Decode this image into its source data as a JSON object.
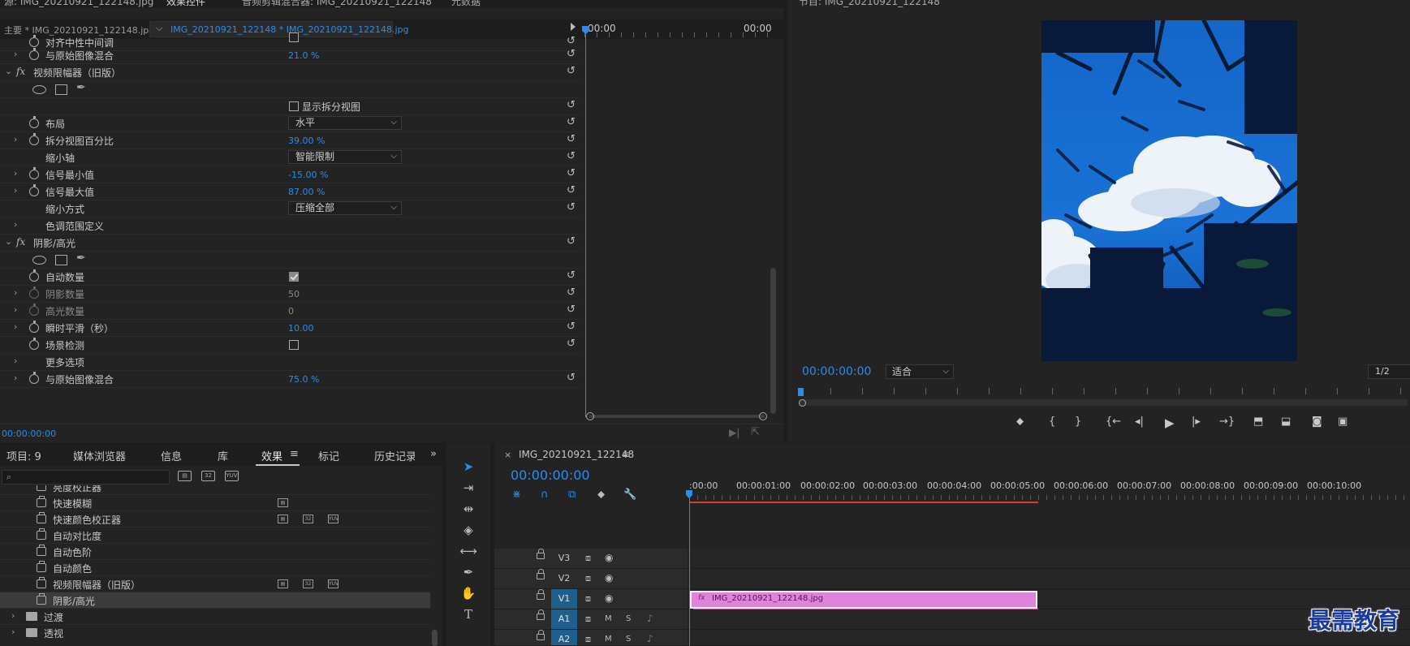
{
  "top_tabs": {
    "source": "源: IMG_20210921_122148.jpg",
    "effect_controls": "效果控件",
    "audio_mixer": "音频剪辑混合器: IMG_20210921_122148",
    "metadata": "元数据",
    "program": "节目: IMG_20210921_122148"
  },
  "effect_controls": {
    "source_label": "主要 * IMG_20210921_122148.jpg",
    "clip_label": "IMG_20210921_122148 * IMG_20210921_122148.jpg",
    "timeline_start": "00:00",
    "timeline_end": "00:00",
    "footer_time": "00:00:00:00",
    "rows": [
      {
        "name": "对齐中性中间调"
      },
      {
        "name": "与原始图像混合",
        "value": "21.0 %"
      },
      {
        "name": "视频限幅器（旧版）"
      },
      {
        "checkbox_label": "显示拆分视图"
      },
      {
        "name": "布局",
        "select": "水平"
      },
      {
        "name": "拆分视图百分比",
        "value": "39.00 %"
      },
      {
        "name": "缩小轴",
        "select": "智能限制"
      },
      {
        "name": "信号最小值",
        "value": "-15.00 %"
      },
      {
        "name": "信号最大值",
        "value": "87.00 %"
      },
      {
        "name": "缩小方式",
        "select": "压缩全部"
      },
      {
        "name": "色调范围定义"
      },
      {
        "name": "阴影/高光"
      },
      {
        "name": "自动数量"
      },
      {
        "name": "阴影数量",
        "value": "50"
      },
      {
        "name": "高光数量",
        "value": "0"
      },
      {
        "name": "瞬时平滑（秒）",
        "value": "10.00"
      },
      {
        "name": "场景检测"
      },
      {
        "name": "更多选项"
      },
      {
        "name": "与原始图像混合",
        "value": "75.0 %"
      }
    ]
  },
  "program_monitor": {
    "timecode": "00:00:00:00",
    "fit": "适合",
    "resolution": "1/2"
  },
  "project_panel": {
    "tabs": [
      "项目: 9",
      "媒体浏览器",
      "信息",
      "库",
      "效果",
      "标记",
      "历史记录"
    ],
    "effects": [
      {
        "name": "亮度校正器"
      },
      {
        "name": "快速模糊"
      },
      {
        "name": "快速颜色校正器"
      },
      {
        "name": "自动对比度"
      },
      {
        "name": "自动色阶"
      },
      {
        "name": "自动颜色"
      },
      {
        "name": "视频限幅器（旧版）"
      },
      {
        "name": "阴影/高光"
      }
    ],
    "folders": [
      "过渡",
      "透视"
    ],
    "badge_labels": [
      "32",
      "YUV"
    ]
  },
  "timeline": {
    "sequence_name": "IMG_20210921_122148",
    "timecode": "00:00:00:00",
    "ruler": [
      ":00:00",
      "00:00:01:00",
      "00:00:02:00",
      "00:00:03:00",
      "00:00:04:00",
      "00:00:05:00",
      "00:00:06:00",
      "00:00:07:00",
      "00:00:08:00",
      "00:00:09:00",
      "00:00:10:00"
    ],
    "tracks": [
      "V3",
      "V2",
      "V1",
      "A1",
      "A2"
    ],
    "track_m": "M",
    "track_s": "S",
    "clip_name": "IMG_20210921_122148.jpg",
    "clip_fx": "fx"
  },
  "watermark": "最需教育"
}
